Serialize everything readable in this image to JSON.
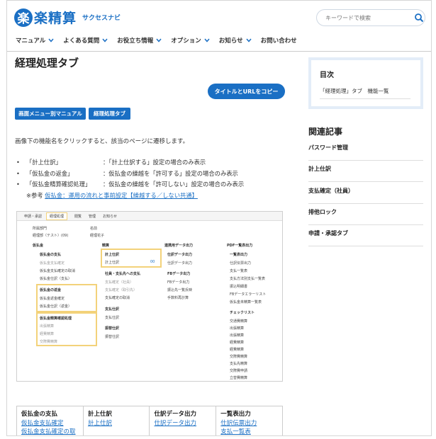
{
  "header": {
    "logo_mark": "楽",
    "logo_text": "楽精算",
    "logo_sub": "サクセスナビ",
    "search_placeholder": "キーワードで検索",
    "nav": [
      "マニュアル",
      "よくある質問",
      "お役立ち情報",
      "オプション",
      "お知らせ",
      "お問い合わせ"
    ]
  },
  "main": {
    "title": "経理処理タブ",
    "copy_button": "タイトルとURLをコピー",
    "tags": [
      "画面メニュー別マニュアル",
      "経理処理タブ"
    ],
    "intro": "画像下の機能名をクリックすると、該当のページに遷移します。",
    "bullets": [
      {
        "label": "「計上仕訳」",
        "desc": "：「計上仕訳する」設定の場合のみ表示"
      },
      {
        "label": "「仮払金の返金」",
        "desc": "：仮払金の繰越を「許可する」設定の場合のみ表示"
      },
      {
        "label": "「仮払金精算確認処理」",
        "desc": "：仮払金の繰越を「許可しない」設定の場合のみ表示"
      }
    ],
    "ref_prefix": "※参考",
    "ref_link": "仮払金：運用の流れと事前設定【繰越する／しない共通】"
  },
  "screenshot": {
    "tabs": [
      "申請・承認",
      "経理処理",
      "閲覧",
      "管理",
      "お知らせ"
    ],
    "dept_label": "所属部門",
    "dept_value": "経理部（テスト）(09)",
    "name_label": "名前",
    "name_value": "経理花子",
    "col1_head": "仮払金",
    "col2_head": "精算",
    "col3_head": "連携用データ出力",
    "col4_head": "PDF一覧表出力",
    "c1_g1": "仮払金の支払",
    "c1_g1_items": [
      "仮払金支払確定",
      "仮払金支払確定の取消",
      "仮払金仕訳（支払）"
    ],
    "c1_g2": "仮払金の返金",
    "c1_g2_items": [
      "仮払金返金確定",
      "仮払金仕訳（返金）"
    ],
    "c1_g3": "仮払金精算確認処理",
    "c1_g3_items": [
      "出張精算",
      "経費精算",
      "交際費精算"
    ],
    "c2_g1": "計上仕訳",
    "c2_g1_items": [
      "計上仕訳"
    ],
    "c2_g2": "社員・支払先への支払",
    "c2_g2_items": [
      "支払確定（社員）",
      "支払確定（取引先）",
      "支払確定の取消"
    ],
    "c2_g3": "支払仕訳",
    "c2_g3_items": [
      "支払仕訳"
    ],
    "c2_g4": "振替仕訳",
    "c2_g4_items": [
      "振替仕訳"
    ],
    "c3_g1": "仕訳データ出力",
    "c3_g1_items": [
      "仕訳データ出力"
    ],
    "c3_g2": "FBデータ出力",
    "c3_g2_items": [
      "FBデータ出力",
      "振込先一覧反映",
      "手数料再計算"
    ],
    "c4_g1": "一覧表出力",
    "c4_g1_items": [
      "仕訳伝票出力",
      "支払一覧表",
      "支払方法別支払一覧表",
      "振込明細書",
      "FBデータエラーリスト",
      "仮払金未精算一覧表"
    ],
    "c4_g2": "チェックリスト",
    "c4_g2_items": [
      "交通費精算",
      "出張精算",
      "出張精算",
      "経費精算",
      "経費精算",
      "交際費精算",
      "支払先精算",
      "交際費申請",
      "立替費精算"
    ],
    "badge": "00"
  },
  "table": [
    {
      "head": "仮払金の支払",
      "links": [
        "仮払金支払確定",
        "仮払金支払確定の取"
      ]
    },
    {
      "head": "計上仕訳",
      "links": [
        "計上仕訳"
      ]
    },
    {
      "head": "仕訳データ出力",
      "links": [
        "仕訳データ出力"
      ]
    },
    {
      "head": "一覧表出力",
      "links": [
        "仕訳伝票出力",
        "支払一覧表"
      ]
    }
  ],
  "sidebar": {
    "toc_title": "目次",
    "toc_item": "「経理処理」タブ　機能一覧",
    "related_title": "関連記事",
    "related": [
      "パスワード管理",
      "計上仕訳",
      "支払確定（社員）",
      "排他ロック",
      "申請・承認タブ"
    ]
  },
  "colors": {
    "accent": "#1a6fc4",
    "highlight": "#f3d27a"
  }
}
